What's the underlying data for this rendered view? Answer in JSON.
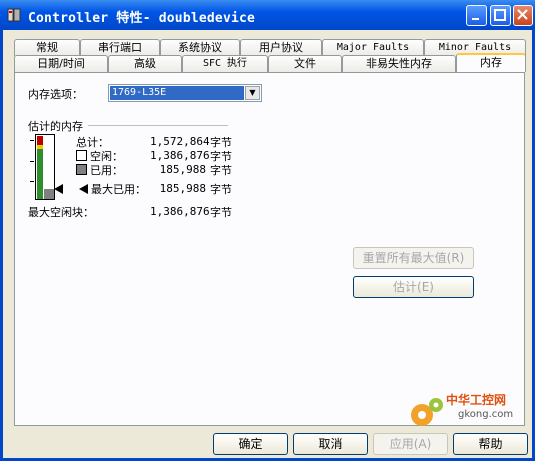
{
  "window": {
    "title": "Controller 特性- doubledevice",
    "buttons": [
      "minimize",
      "maximize",
      "close"
    ]
  },
  "tabs_row1": [
    "常规",
    "串行端口",
    "系统协议",
    "用户协议",
    "Major Faults",
    "Minor Faults"
  ],
  "tabs_row2": [
    "日期/时间",
    "高级",
    "SFC 执行",
    "文件",
    "非易失性内存",
    "内存"
  ],
  "active_tab": "内存",
  "memory_option": {
    "label": "内存选项：",
    "value": "1769-L35E"
  },
  "estimate": {
    "group_title": "估计的内存",
    "rows": [
      {
        "label": "总计：",
        "value": "1,572,864",
        "unit": "字节"
      },
      {
        "label": "空闲：",
        "value": "1,386,876",
        "unit": "字节"
      },
      {
        "label": "已用：",
        "value": "185,988",
        "unit": "字节"
      },
      {
        "label": "最大已用：",
        "value": "185,988",
        "unit": "字节"
      }
    ],
    "max_free_block": {
      "label": "最大空闲块：",
      "value": "1,386,876",
      "unit": "字节"
    },
    "used_fraction": 0.118
  },
  "actions": {
    "reset_max": "重置所有最大值(R)",
    "estimate": "估计(E)"
  },
  "footer": {
    "ok": "确定",
    "cancel": "取消",
    "apply": "应用(A)",
    "help": "帮助"
  },
  "watermark": {
    "text": "中华工控网",
    "url": "gkong.com"
  },
  "colors": {
    "titlebar": "#0055e5",
    "accent_tab": "#ffc83c",
    "selection": "#316ac5",
    "gauge_used": "#2f8f2f",
    "gauge_warn": "#c00000"
  }
}
